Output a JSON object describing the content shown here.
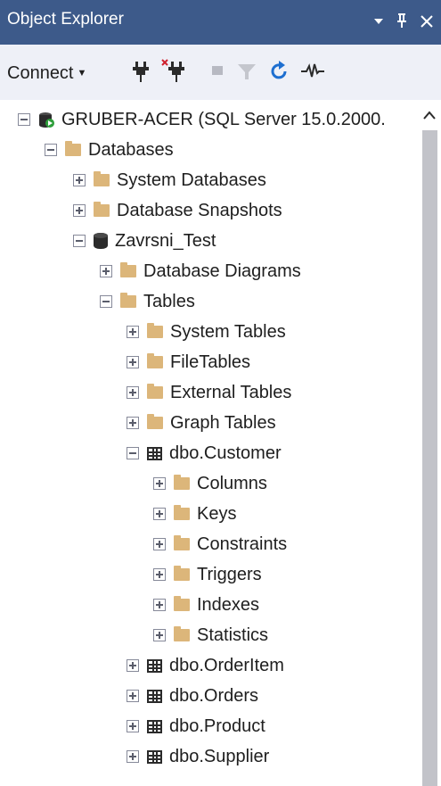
{
  "window": {
    "title": "Object Explorer",
    "controls": {
      "dropdown": "dropdown-arrow-icon",
      "pin": "pin-icon",
      "close": "close-icon"
    }
  },
  "toolbar": {
    "connect_label": "Connect",
    "buttons": [
      {
        "name": "connect-object-explorer-icon"
      },
      {
        "name": "disconnect-icon"
      },
      {
        "name": "stop-icon"
      },
      {
        "name": "filter-icon"
      },
      {
        "name": "refresh-icon"
      },
      {
        "name": "activity-monitor-icon"
      }
    ]
  },
  "colors": {
    "titlebar": "#3d5a8a",
    "toolbar": "#eef0f7",
    "folder": "#dcb67a",
    "refresh": "#1e6fd0",
    "server_badge": "#2e9e3a"
  },
  "tree": {
    "server": "GRUBER-ACER (SQL Server 15.0.2000.",
    "databases": "Databases",
    "system_databases": "System Databases",
    "database_snapshots": "Database Snapshots",
    "database": "Zavrsni_Test",
    "database_diagrams": "Database Diagrams",
    "tables": "Tables",
    "system_tables": "System Tables",
    "file_tables": "FileTables",
    "external_tables": "External Tables",
    "graph_tables": "Graph Tables",
    "customer_table": "dbo.Customer",
    "columns": "Columns",
    "keys": "Keys",
    "constraints": "Constraints",
    "triggers": "Triggers",
    "indexes": "Indexes",
    "statistics": "Statistics",
    "orderitem_table": "dbo.OrderItem",
    "orders_table": "dbo.Orders",
    "product_table": "dbo.Product",
    "supplier_table": "dbo.Supplier"
  }
}
